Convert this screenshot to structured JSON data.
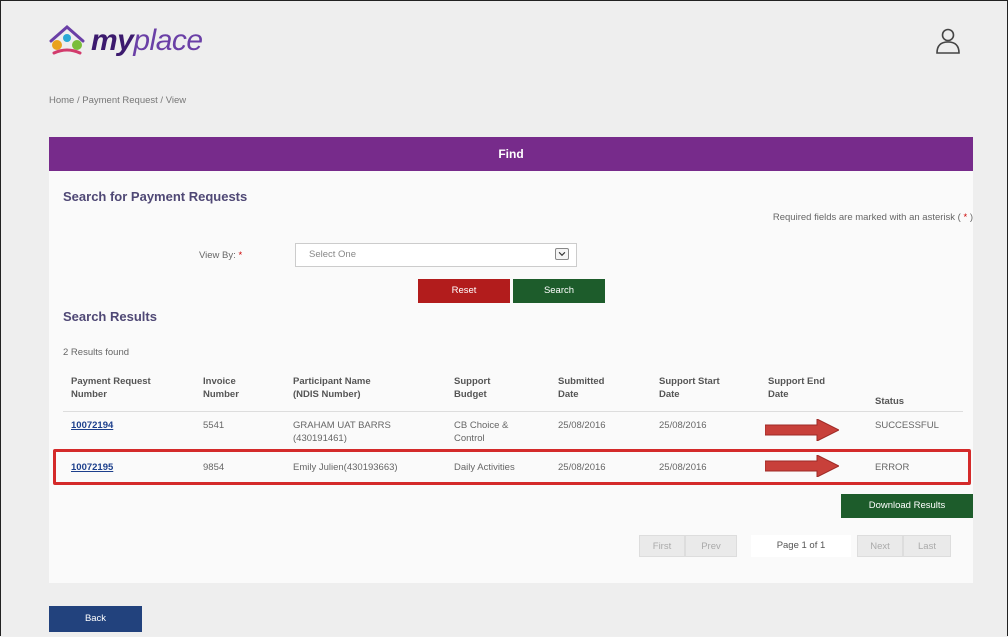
{
  "header": {
    "logo_my": "my",
    "logo_place": "place"
  },
  "breadcrumb": "Home /  Payment Request  /  View",
  "find_bar": "Find",
  "search_section": {
    "title": "Search for Payment Requests",
    "required_note_prefix": "Required fields are marked with an asterisk (",
    "required_note_asterisk": " * ",
    "required_note_suffix": ")",
    "view_by_label": "View By:",
    "view_by_asterisk": "*",
    "view_by_selected": "Select One",
    "reset_label": "Reset",
    "search_label": "Search"
  },
  "results_section": {
    "title": "Search Results",
    "count_text": "2 Results found",
    "columns": [
      [
        "Payment Request",
        "Number"
      ],
      [
        "Invoice",
        "Number"
      ],
      [
        "Participant Name",
        "(NDIS Number)"
      ],
      [
        "Support",
        "Budget"
      ],
      [
        "Submitted",
        "Date"
      ],
      [
        "Support Start",
        "Date"
      ],
      [
        "Support End",
        "Date"
      ],
      [
        "Status",
        ""
      ]
    ],
    "rows": [
      {
        "payment_request": "10072194",
        "invoice": "5541",
        "participant": [
          "GRAHAM UAT BARRS",
          "(430191461)"
        ],
        "budget": [
          "CB Choice &",
          "Control"
        ],
        "submitted": "25/08/2016",
        "start": "25/08/2016",
        "status": "SUCCESSFUL"
      },
      {
        "payment_request": "10072195",
        "invoice": "9854",
        "participant": [
          "Emily Julien(430193663)",
          ""
        ],
        "budget": [
          "Daily Activities",
          ""
        ],
        "submitted": "25/08/2016",
        "start": "25/08/2016",
        "status": "ERROR"
      }
    ],
    "download_label": "Download Results"
  },
  "pager": {
    "first": "First",
    "prev": "Prev",
    "page_label": "Page 1 of 1",
    "next": "Next",
    "last": "Last"
  },
  "back_label": "Back",
  "colors": {
    "find_bar": "#772b8b",
    "reset": "#b21c1c",
    "search": "#1d5c2b",
    "back": "#22427d",
    "highlight": "#d42a2a",
    "arrow": "#c8403a"
  }
}
